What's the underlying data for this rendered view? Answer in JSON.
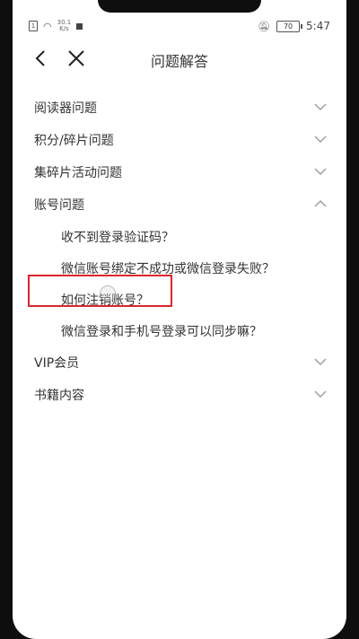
{
  "status_bar": {
    "speed_value": "30.1",
    "speed_unit": "K/s",
    "battery": "70",
    "time": "5:47"
  },
  "header": {
    "title": "问题解答"
  },
  "categories": [
    {
      "label": "阅读器问题",
      "expanded": false
    },
    {
      "label": "积分/碎片问题",
      "expanded": false
    },
    {
      "label": "集碎片活动问题",
      "expanded": false
    },
    {
      "label": "账号问题",
      "expanded": true
    },
    {
      "label": "VIP会员",
      "expanded": false
    },
    {
      "label": "书籍内容",
      "expanded": false
    }
  ],
  "account_questions": [
    "收不到登录验证码？",
    "微信账号绑定不成功或微信登录失败？",
    "如何注销账号？",
    "微信登录和手机号登录可以同步嘛？"
  ],
  "colors": {
    "highlight": "#d9262b",
    "text": "#333333",
    "chevron": "#9a9a9a"
  }
}
